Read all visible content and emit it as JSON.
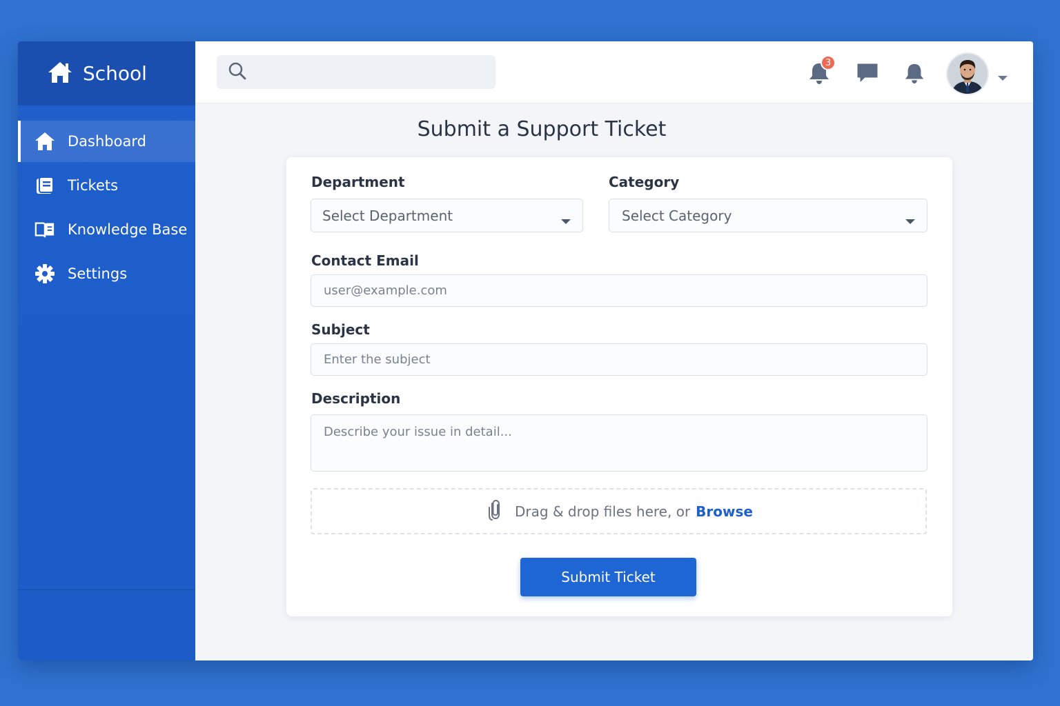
{
  "brand": {
    "label": "School",
    "icon": "home-icon"
  },
  "sidebar": {
    "items": [
      {
        "label": "Dashboard",
        "icon": "home-icon",
        "active": true
      },
      {
        "label": "Tickets",
        "icon": "ticket-icon",
        "active": false
      },
      {
        "label": "Knowledge Base",
        "icon": "book-icon",
        "active": false
      },
      {
        "label": "Settings",
        "icon": "gear-icon",
        "active": false
      }
    ]
  },
  "topbar": {
    "search": {
      "placeholder": "",
      "value": ""
    },
    "notifications": {
      "count": "3"
    },
    "icons": [
      "bell-icon",
      "chat-icon",
      "bell-icon"
    ]
  },
  "page": {
    "title": "Submit a Support Ticket"
  },
  "form": {
    "department": {
      "label": "Department",
      "value": "Select Department"
    },
    "category": {
      "label": "Category",
      "value": "Select Category"
    },
    "email": {
      "label": "Contact Email",
      "placeholder": "user@example.com"
    },
    "subject": {
      "label": "Subject",
      "placeholder": "Enter the subject"
    },
    "description": {
      "label": "Description",
      "placeholder": "Describe your issue in detail..."
    },
    "upload": {
      "text": "Drag & drop files here, or",
      "link": "Browse"
    },
    "submit_label": "Submit Ticket"
  },
  "colors": {
    "background": "#2f72cf",
    "sidebar": "#1f5fcc",
    "brand_bar": "#1a4fb0",
    "accent": "#1e66d4",
    "badge": "#ee6a52"
  }
}
